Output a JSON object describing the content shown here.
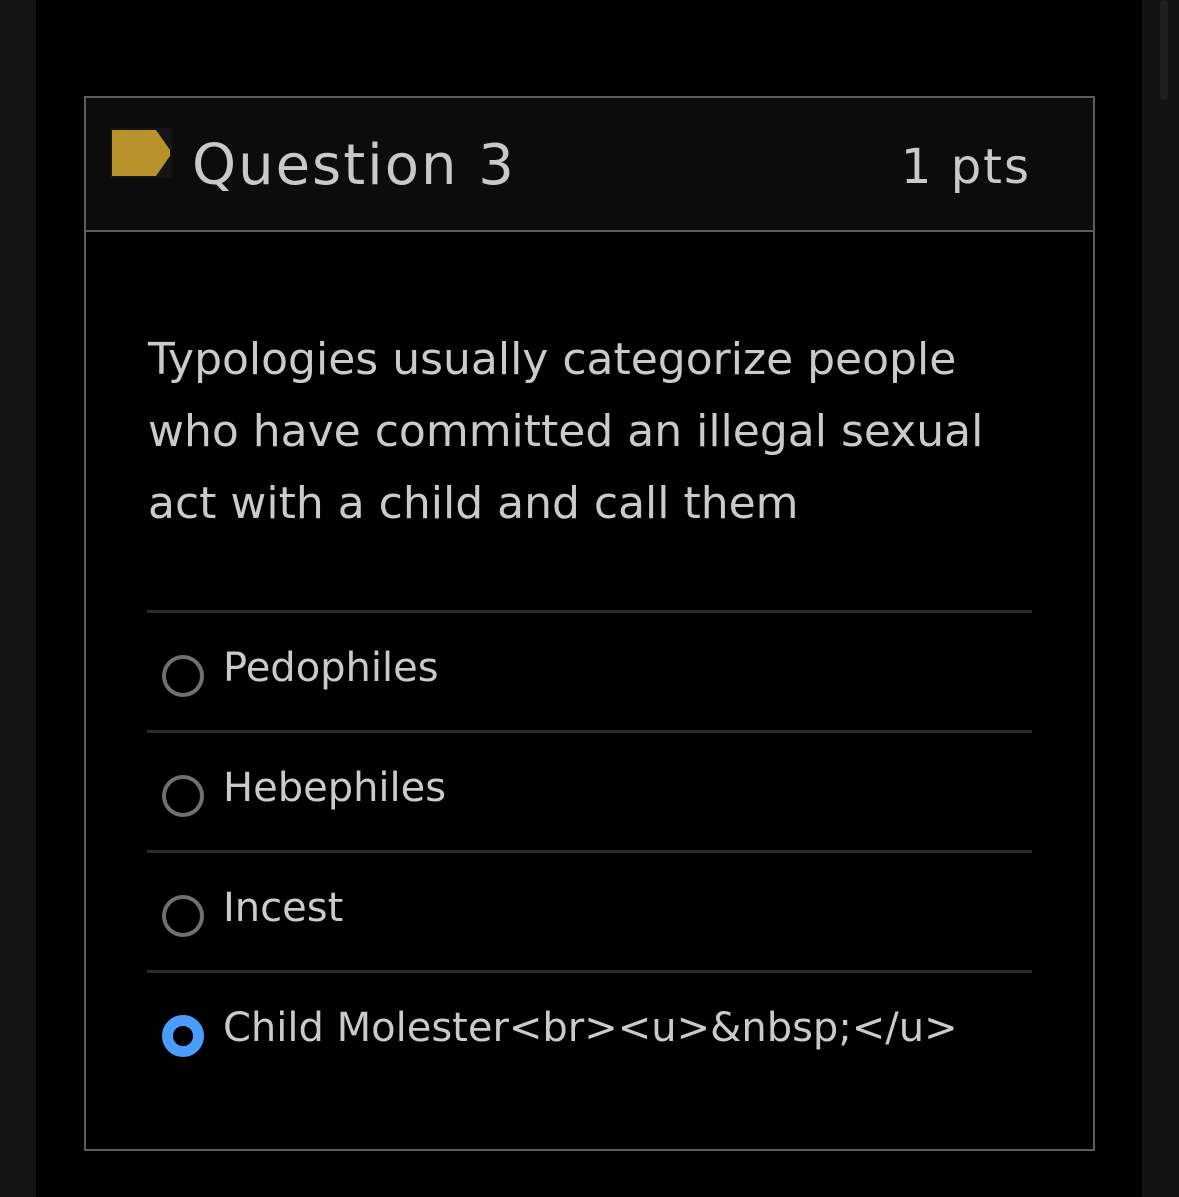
{
  "question": {
    "title": "Question 3",
    "points": "1 pts",
    "flag_icon": "flag-icon",
    "flag_color": "#b8922b",
    "text": "Typologies usually categorize people who have committed an illegal sexual act with a child and call them"
  },
  "answers": [
    {
      "label": "Pedophiles",
      "selected": false
    },
    {
      "label": "Hebephiles",
      "selected": false
    },
    {
      "label": "Incest",
      "selected": false
    },
    {
      "label": "Child Molester<br><u>&nbsp;</u>",
      "selected": true
    }
  ],
  "colors": {
    "accent": "#4a9cff",
    "border": "#5c5c5c",
    "text": "#cacaca",
    "background": "#000000"
  }
}
